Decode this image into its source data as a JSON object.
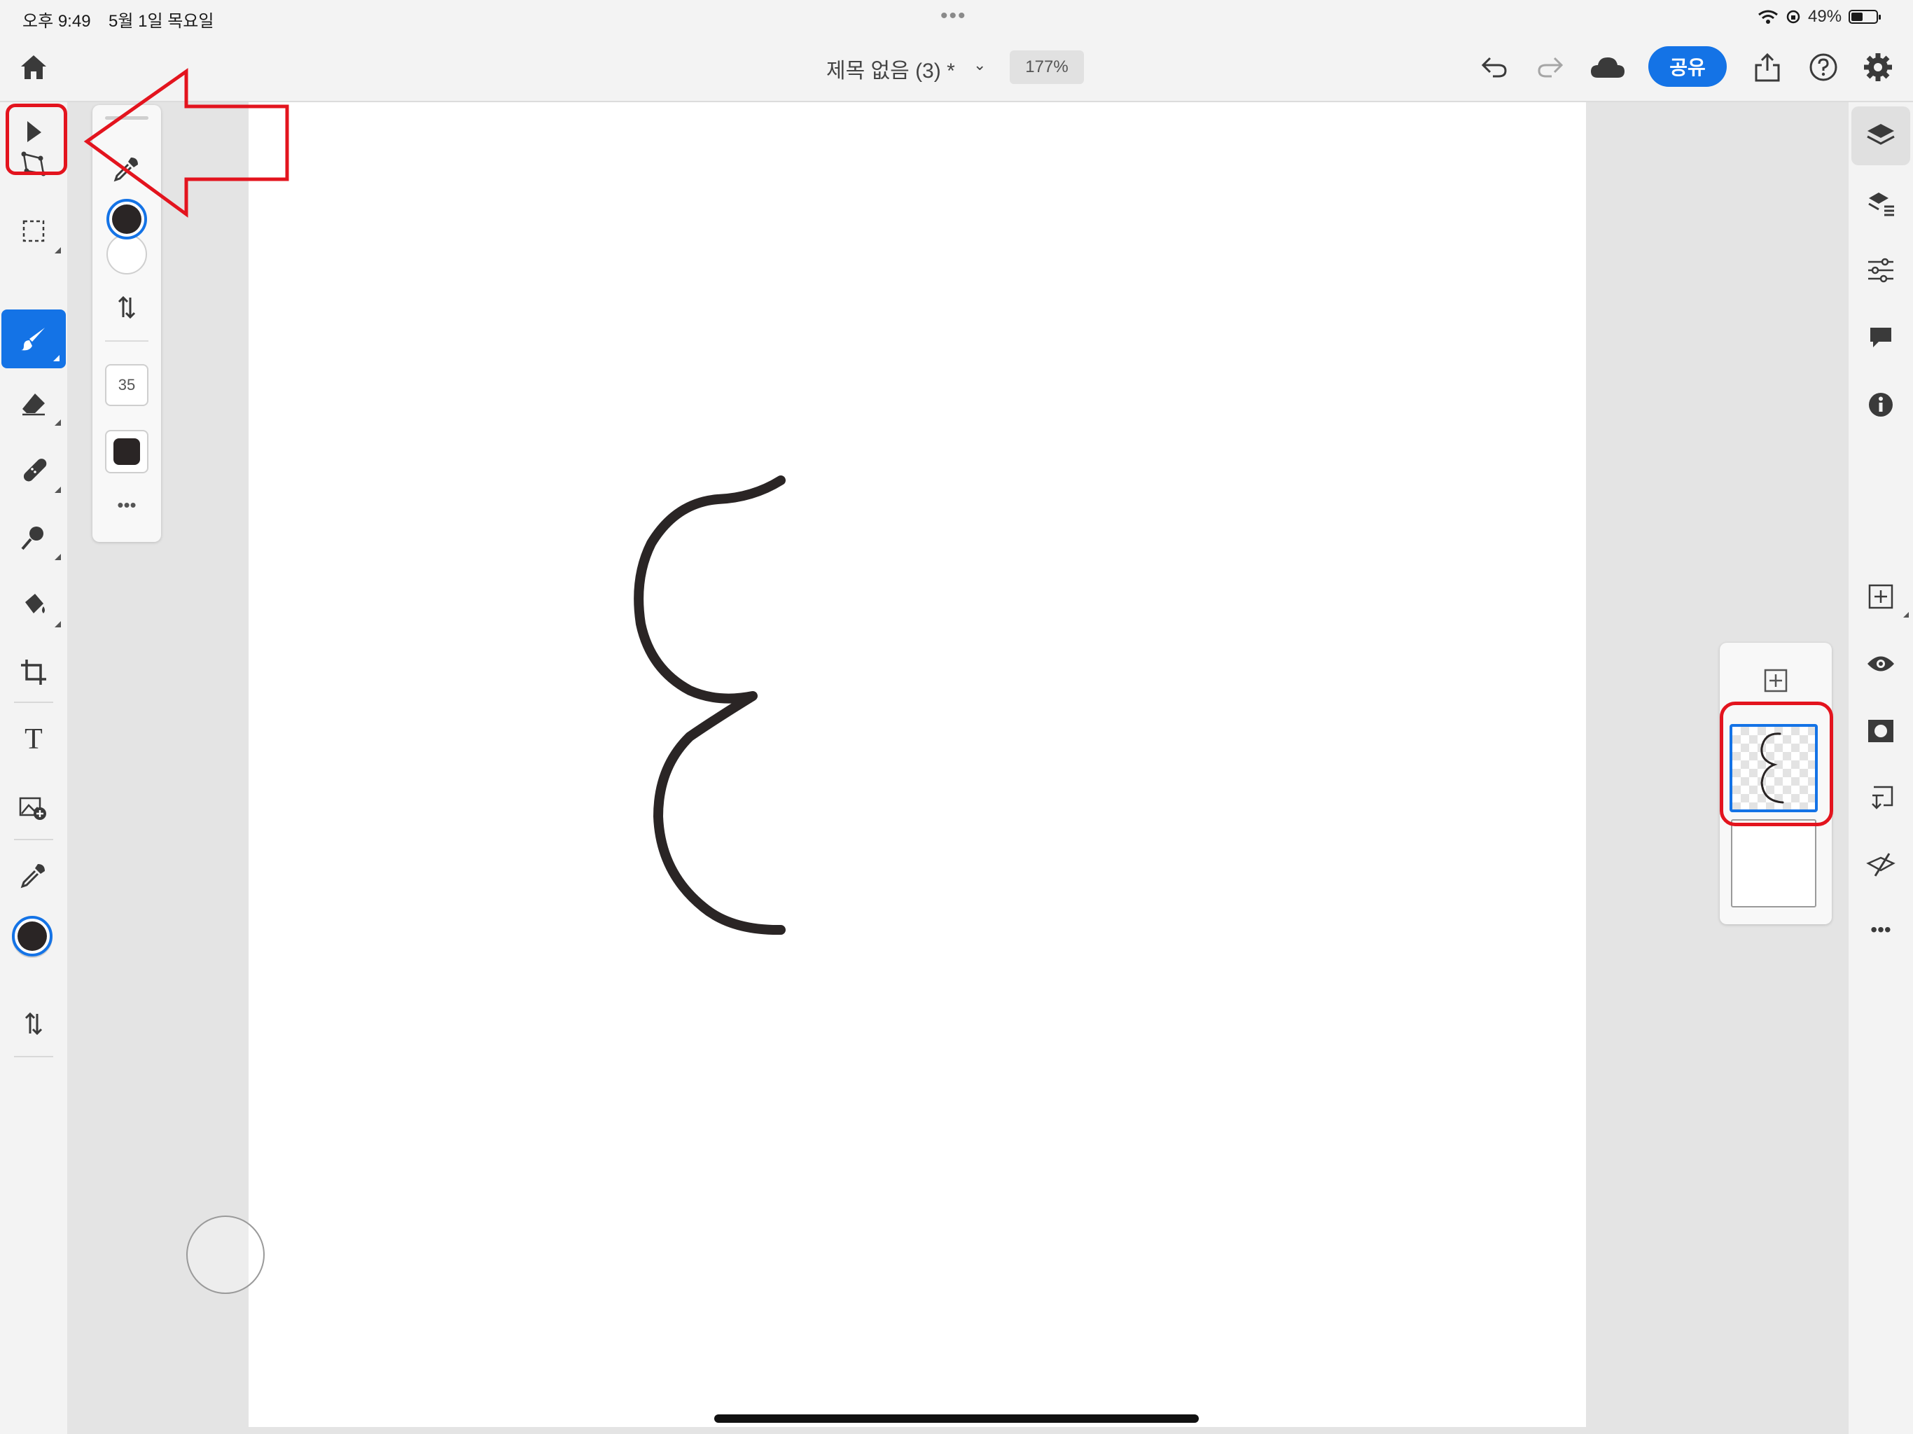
{
  "status_bar": {
    "time": "오후 9:49",
    "date": "5월 1일 목요일",
    "dots": "•••",
    "battery": "49%",
    "icons": [
      "wifi-icon",
      "orientation-lock-icon",
      "battery-icon"
    ]
  },
  "header": {
    "title": "제목 없음 (3) *",
    "chevron": "⌄",
    "zoom": "177%",
    "share_label": "공유",
    "icons": [
      "home-icon",
      "undo-icon",
      "redo-icon",
      "cloud-icon",
      "export-icon",
      "help-icon",
      "settings-icon"
    ]
  },
  "left_toolbar": {
    "tools": [
      "select-tool",
      "transform-tool",
      "marquee-selection-tool",
      "brush-tool",
      "eraser-tool",
      "healing-tool",
      "clone-stamp-tool",
      "fill-tool",
      "crop-tool",
      "type-tool",
      "place-image-tool",
      "eyedropper-tool",
      "color-swatches",
      "swap-colors"
    ],
    "selected_tool": "brush-tool",
    "type_tool_glyph": "T",
    "foreground_color": "#2a2525",
    "background_color": "#ffffff"
  },
  "brush_options": {
    "brush_size": "35",
    "more": "•••",
    "icons": [
      "panel-drag-handle",
      "eyedropper-icon",
      "color-swatches",
      "swap-colors-icon",
      "brush-tip-shape"
    ]
  },
  "right_toolbar": {
    "icons": [
      "layers-icon",
      "layer-properties-icon",
      "adjustments-icon",
      "comments-icon",
      "info-icon",
      "add-layer-icon",
      "visibility-icon",
      "mask-icon",
      "clipping-mask-icon",
      "merge-down-icon",
      "more-icon"
    ],
    "more": "•••"
  },
  "layers_panel": {
    "layers": [
      {
        "name": "drawing-layer",
        "selected": true
      },
      {
        "name": "background-layer",
        "selected": false
      }
    ]
  },
  "colors": {
    "accent": "#1473e6",
    "annotation": "#e3141e",
    "ink": "#2a2525"
  }
}
